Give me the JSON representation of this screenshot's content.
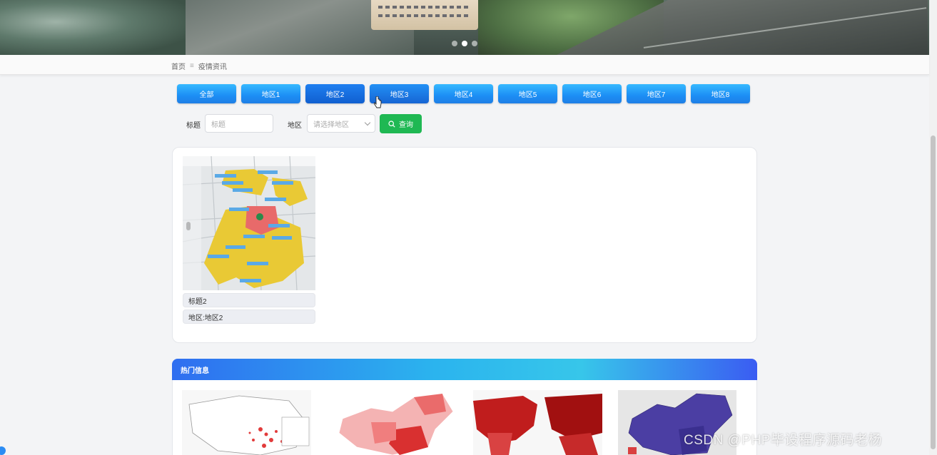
{
  "banner": {
    "slides": 3,
    "active_slide": 2
  },
  "breadcrumb": {
    "home": "首页",
    "separator": "≡",
    "current": "疫情资讯"
  },
  "tabs": [
    {
      "label": "全部"
    },
    {
      "label": "地区1"
    },
    {
      "label": "地区2"
    },
    {
      "label": "地区3"
    },
    {
      "label": "地区4"
    },
    {
      "label": "地区5"
    },
    {
      "label": "地区6"
    },
    {
      "label": "地区7"
    },
    {
      "label": "地区8"
    }
  ],
  "search": {
    "title_label": "标题",
    "title_placeholder": "标题",
    "region_label": "地区",
    "region_placeholder": "请选择地区",
    "query_button": "查询"
  },
  "results": [
    {
      "title": "标题2",
      "region": "地区:地区2"
    }
  ],
  "hot": {
    "header": "热门信息"
  },
  "watermark": "CSDN @PHP毕设程序源码老杨",
  "colors": {
    "tab_blue": "#1c8ef5",
    "query_green": "#1fb853",
    "hot_header": "#2bb4ee"
  }
}
